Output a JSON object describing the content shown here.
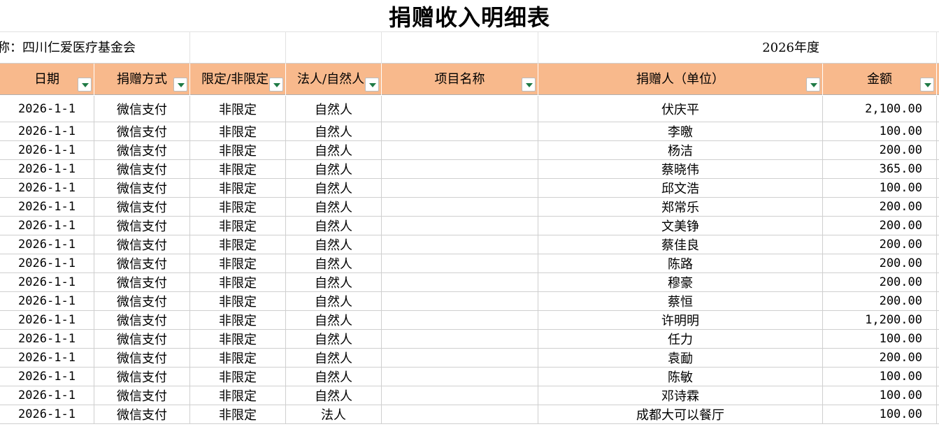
{
  "sheet": {
    "title": "捐赠收入明细表",
    "org_name": "称：四川仁爱医疗基金会",
    "year": "2026年度"
  },
  "columns": [
    {
      "label": "日期",
      "has_filter": true
    },
    {
      "label": "捐赠方式",
      "has_filter": true
    },
    {
      "label": "限定/非限定",
      "has_filter": true
    },
    {
      "label": "法人/自然人",
      "has_filter": true
    },
    {
      "label": "项目名称",
      "has_filter": true
    },
    {
      "label": "捐赠人（单位）",
      "has_filter": true
    },
    {
      "label": "金额",
      "has_filter": true
    }
  ],
  "rows": [
    {
      "date": "2026-1-1",
      "method": "微信支付",
      "restriction": "非限定",
      "donor_type": "自然人",
      "project": "",
      "donor": "伏庆平",
      "amount": "2,100.00"
    },
    {
      "date": "2026-1-1",
      "method": "微信支付",
      "restriction": "非限定",
      "donor_type": "自然人",
      "project": "",
      "donor": "李曒",
      "amount": "100.00"
    },
    {
      "date": "2026-1-1",
      "method": "微信支付",
      "restriction": "非限定",
      "donor_type": "自然人",
      "project": "",
      "donor": "杨洁",
      "amount": "200.00"
    },
    {
      "date": "2026-1-1",
      "method": "微信支付",
      "restriction": "非限定",
      "donor_type": "自然人",
      "project": "",
      "donor": "蔡晓伟",
      "amount": "365.00"
    },
    {
      "date": "2026-1-1",
      "method": "微信支付",
      "restriction": "非限定",
      "donor_type": "自然人",
      "project": "",
      "donor": "邱文浩",
      "amount": "100.00"
    },
    {
      "date": "2026-1-1",
      "method": "微信支付",
      "restriction": "非限定",
      "donor_type": "自然人",
      "project": "",
      "donor": "郑常乐",
      "amount": "200.00"
    },
    {
      "date": "2026-1-1",
      "method": "微信支付",
      "restriction": "非限定",
      "donor_type": "自然人",
      "project": "",
      "donor": "文美铮",
      "amount": "200.00"
    },
    {
      "date": "2026-1-1",
      "method": "微信支付",
      "restriction": "非限定",
      "donor_type": "自然人",
      "project": "",
      "donor": "蔡佳良",
      "amount": "200.00"
    },
    {
      "date": "2026-1-1",
      "method": "微信支付",
      "restriction": "非限定",
      "donor_type": "自然人",
      "project": "",
      "donor": "陈路",
      "amount": "200.00"
    },
    {
      "date": "2026-1-1",
      "method": "微信支付",
      "restriction": "非限定",
      "donor_type": "自然人",
      "project": "",
      "donor": "穆豪",
      "amount": "200.00"
    },
    {
      "date": "2026-1-1",
      "method": "微信支付",
      "restriction": "非限定",
      "donor_type": "自然人",
      "project": "",
      "donor": "蔡恒",
      "amount": "200.00"
    },
    {
      "date": "2026-1-1",
      "method": "微信支付",
      "restriction": "非限定",
      "donor_type": "自然人",
      "project": "",
      "donor": "许明明",
      "amount": "1,200.00"
    },
    {
      "date": "2026-1-1",
      "method": "微信支付",
      "restriction": "非限定",
      "donor_type": "自然人",
      "project": "",
      "donor": "任力",
      "amount": "100.00"
    },
    {
      "date": "2026-1-1",
      "method": "微信支付",
      "restriction": "非限定",
      "donor_type": "自然人",
      "project": "",
      "donor": "袁勔",
      "amount": "200.00"
    },
    {
      "date": "2026-1-1",
      "method": "微信支付",
      "restriction": "非限定",
      "donor_type": "自然人",
      "project": "",
      "donor": "陈敏",
      "amount": "100.00"
    },
    {
      "date": "2026-1-1",
      "method": "微信支付",
      "restriction": "非限定",
      "donor_type": "自然人",
      "project": "",
      "donor": "邓诗霖",
      "amount": "100.00"
    },
    {
      "date": "2026-1-1",
      "method": "微信支付",
      "restriction": "非限定",
      "donor_type": "法人",
      "project": "",
      "donor": "成都大可以餐厅",
      "amount": "100.00"
    }
  ],
  "colors": {
    "header_fill": "#f8b98c",
    "filter_arrow": "#1f7a45",
    "gridline": "#cfcfcf"
  }
}
